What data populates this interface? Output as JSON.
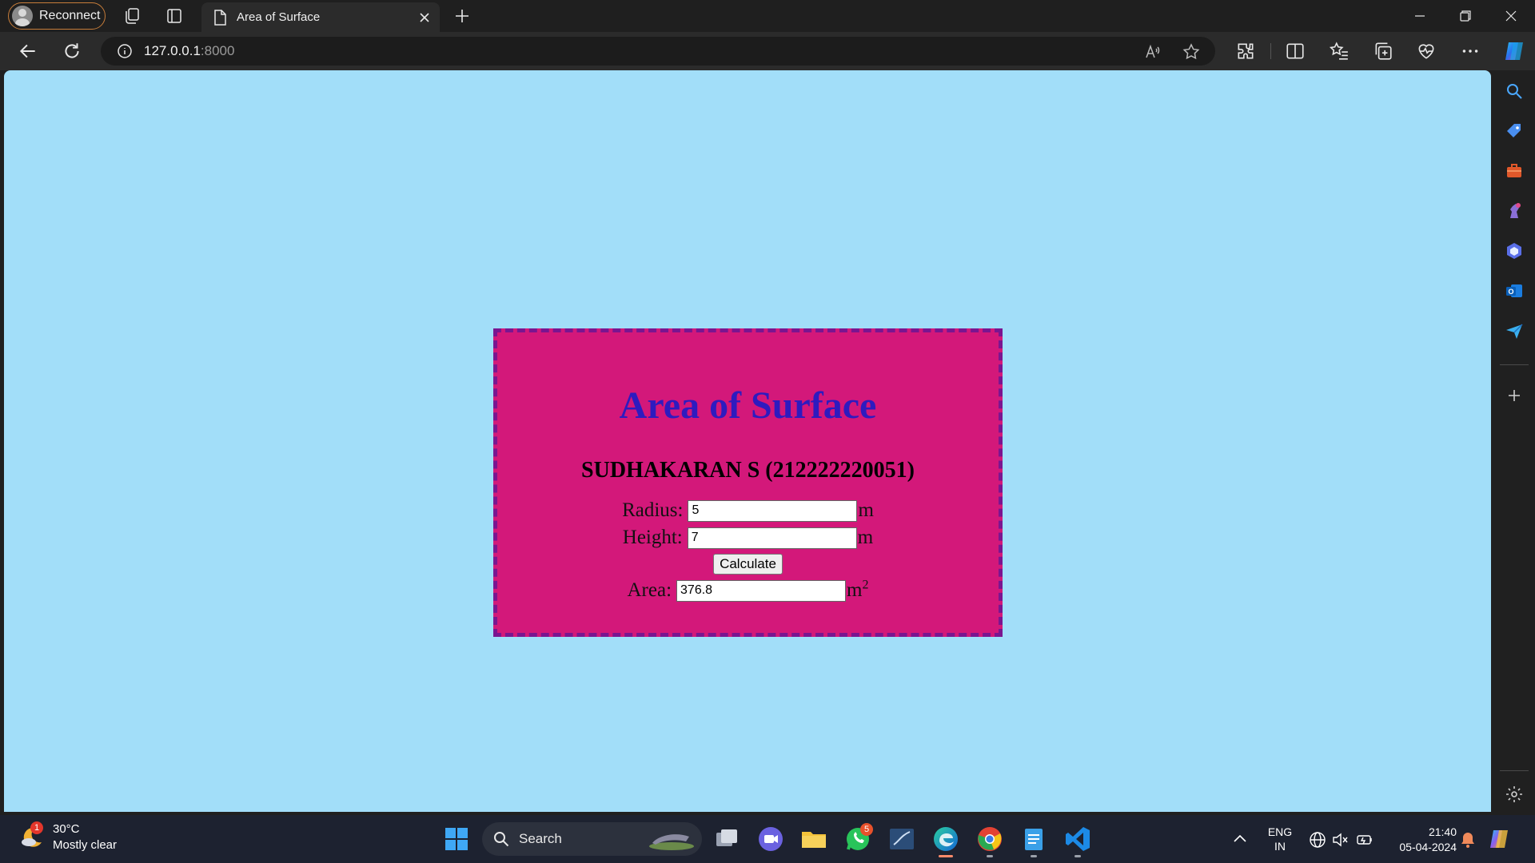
{
  "browser": {
    "profile_label": "Reconnect",
    "tab_title": "Area of Surface",
    "url_host": "127.0.0.1",
    "url_port": ":8000"
  },
  "page": {
    "heading": "Area of Surface",
    "subheading": "SUDHAKARAN S (212222220051)",
    "radius_label": "Radius:",
    "radius_value": "5",
    "radius_unit": "m",
    "height_label": "Height:",
    "height_value": "7",
    "height_unit": "m",
    "calculate_label": "Calculate",
    "area_label": "Area:",
    "area_value": "376.8",
    "area_unit": "m",
    "area_unit_exponent": "2",
    "colors": {
      "background": "#a2def9",
      "card": "#d3187a",
      "card_border": "#7a1590",
      "heading": "#2e1bbf"
    }
  },
  "taskbar": {
    "weather_temp": "30°C",
    "weather_desc": "Mostly clear",
    "weather_badge": "1",
    "search_label": "Search",
    "whatsapp_badge": "5",
    "lang_top": "ENG",
    "lang_bottom": "IN",
    "time": "21:40",
    "date": "05-04-2024"
  }
}
